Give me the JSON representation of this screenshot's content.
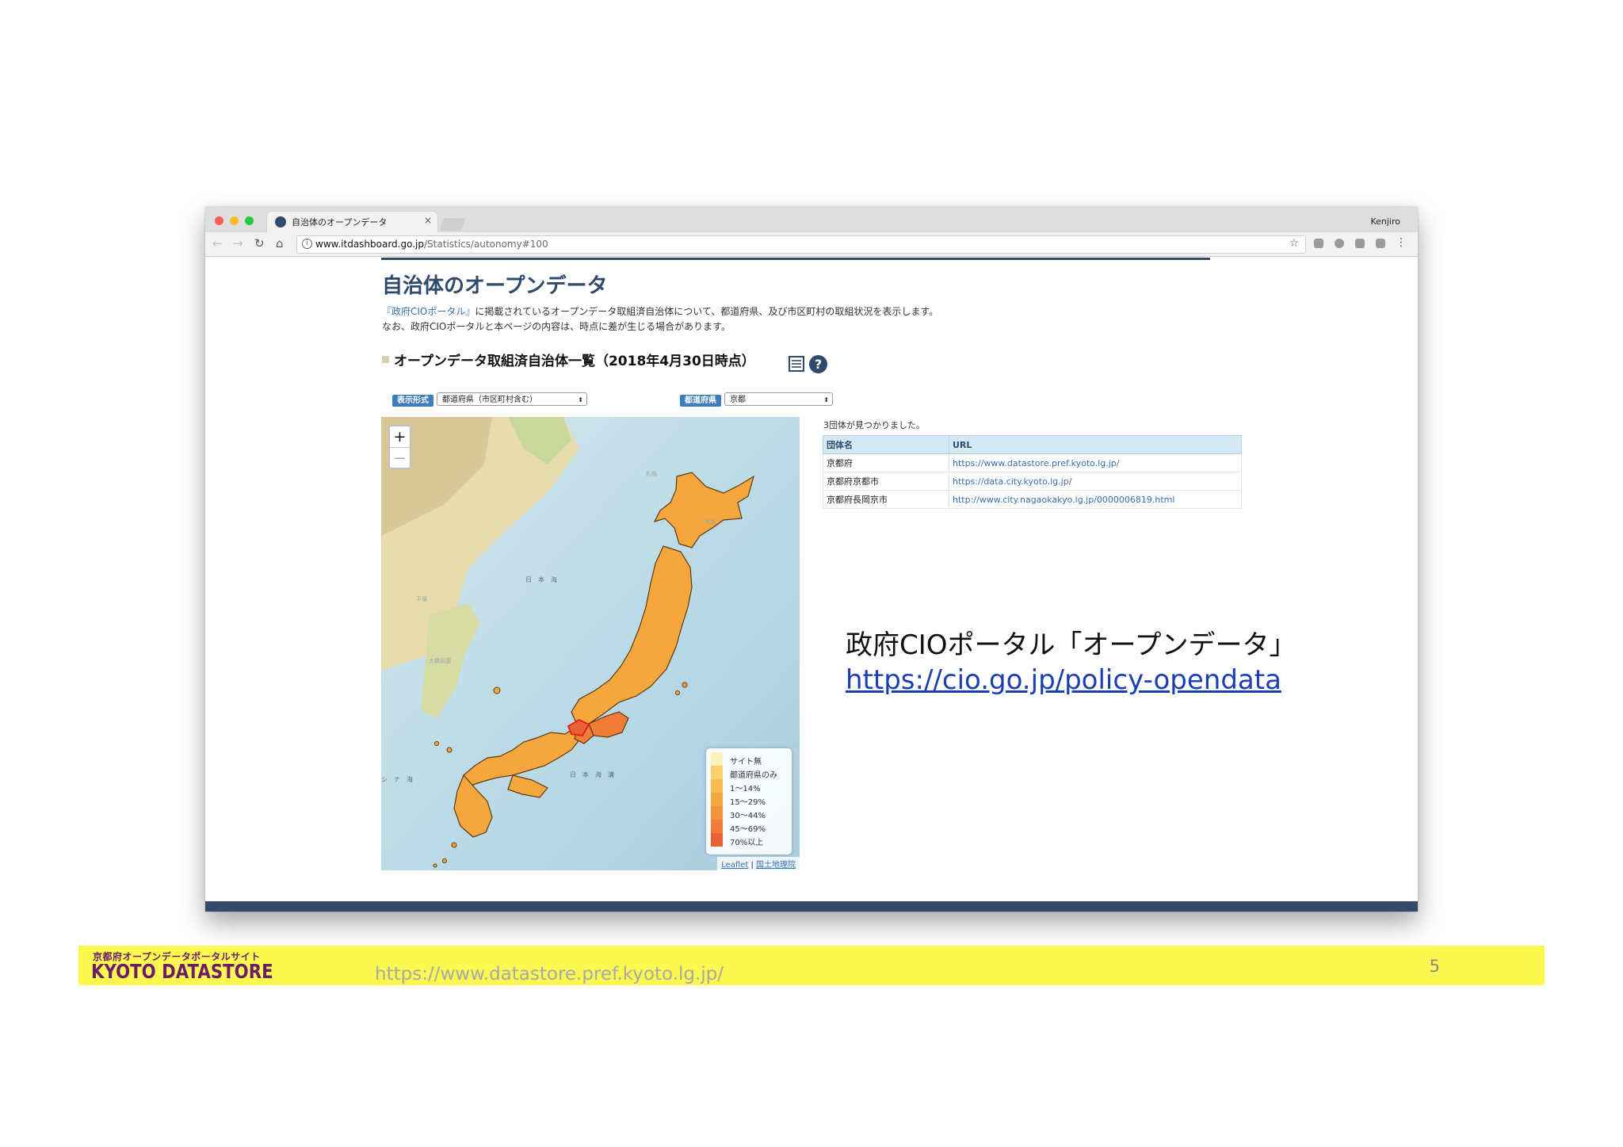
{
  "window": {
    "tab_title": "自治体のオープンデータ",
    "tab_close": "×",
    "user_name": "Kenjiro"
  },
  "toolbar": {
    "back": "←",
    "forward": "→",
    "reload": "↻",
    "home": "⌂",
    "url_host": "www.itdashboard.go.jp",
    "url_path": "/Statistics/autonomy#100",
    "bookmark": "☆",
    "menu": "⋮"
  },
  "page": {
    "title": "自治体のオープンデータ",
    "intro_link": "『政府CIOポータル』",
    "intro_line1_rest": "に掲載されているオープンデータ取組済自治体について、都道府県、及び市区町村の取組状況を表示します。",
    "intro_line2": "なお、政府CIOポータルと本ページの内容は、時点に差が生じる場合があります。",
    "section_title": "オープンデータ取組済自治体一覧（2018年4月30日時点）",
    "help_glyph": "?"
  },
  "filters": {
    "display_label": "表示形式",
    "display_value": "都道府県（市区町村含む）",
    "prefecture_label": "都道府県",
    "prefecture_value": "京都",
    "caret": "⬍"
  },
  "map": {
    "zoom_in": "+",
    "zoom_out": "−",
    "attribution_leaflet": "Leaflet",
    "attribution_sep": " | ",
    "attribution_gsi": "国土地理院",
    "legend": [
      {
        "label": "サイト無",
        "color": "#fdf1c0"
      },
      {
        "label": "都道府県のみ",
        "color": "#fbd26a"
      },
      {
        "label": "1〜14%",
        "color": "#f8bd4e"
      },
      {
        "label": "15〜29%",
        "color": "#f6a83f"
      },
      {
        "label": "30〜44%",
        "color": "#f39439"
      },
      {
        "label": "45〜69%",
        "color": "#f07c37"
      },
      {
        "label": "70%以上",
        "color": "#eb6136"
      }
    ]
  },
  "results": {
    "count_text": "3団体が見つかりました。",
    "columns": [
      "団体名",
      "URL"
    ],
    "rows": [
      {
        "name": "京都府",
        "url": "https://www.datastore.pref.kyoto.lg.jp/"
      },
      {
        "name": "京都府京都市",
        "url": "https://data.city.kyoto.lg.jp/"
      },
      {
        "name": "京都府長岡京市",
        "url": "http://www.city.nagaokakyo.lg.jp/0000006819.html"
      }
    ]
  },
  "slide": {
    "caption": "政府CIOポータル「オープンデータ」",
    "caption_link": "https://cio.go.jp/policy-opendata",
    "brand_sub": "京都府オープンデータポータルサイト",
    "brand_main": "KYOTO DATASTORE",
    "footer_url": "https://www.datastore.pref.kyoto.lg.jp/",
    "page_number": "5"
  }
}
